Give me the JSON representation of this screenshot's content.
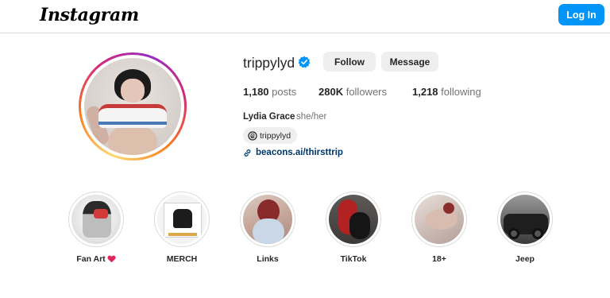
{
  "header": {
    "logo_text": "Instagram",
    "login_label": "Log In",
    "accent_color": "#0095f6"
  },
  "profile": {
    "username": "trippylyd",
    "verified": true,
    "verified_icon": "verified-badge-icon",
    "follow_label": "Follow",
    "message_label": "Message",
    "stats": {
      "posts_count": "1,180",
      "posts_label": "posts",
      "followers_count": "280K",
      "followers_label": "followers",
      "following_count": "1,218",
      "following_label": "following"
    },
    "full_name": "Lydia Grace",
    "pronouns": "she/her",
    "threads_handle": "trippylyd",
    "threads_icon": "threads-icon",
    "link_icon": "link-icon",
    "link_text": "beacons.ai/thirsttrip"
  },
  "highlights": [
    {
      "label": "Fan Art",
      "emoji_icon": "heart-icon"
    },
    {
      "label": "MERCH"
    },
    {
      "label": "Links"
    },
    {
      "label": "TikTok"
    },
    {
      "label": "18+"
    },
    {
      "label": "Jeep"
    }
  ]
}
